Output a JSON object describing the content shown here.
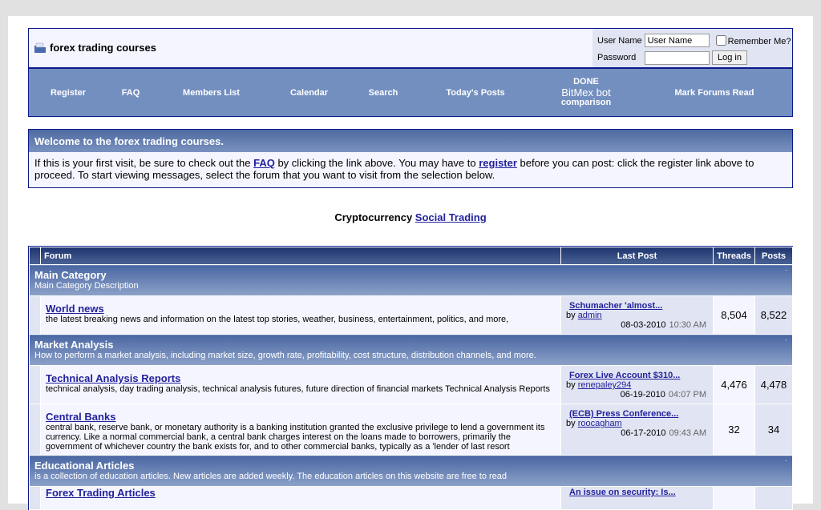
{
  "header": {
    "title": "forex trading courses",
    "login": {
      "username_label": "User Name",
      "username_value": "User Name",
      "remember_label": "Remember Me?",
      "password_label": "Password",
      "login_button": "Log in"
    }
  },
  "nav": {
    "items": [
      "Register",
      "FAQ",
      "Members List",
      "Calendar",
      "Search",
      "Today's Posts"
    ],
    "special": {
      "line1": "DONE",
      "line2": "BitMex bot",
      "line3": "comparison"
    },
    "mark_read": "Mark Forums Read"
  },
  "welcome": {
    "title": "Welcome to the forex trading courses.",
    "p1": "If this is your first visit, be sure to check out the ",
    "faq": "FAQ",
    "p2": " by clicking the link above. You may have to ",
    "register": "register",
    "p3": " before you can post: click the register link above to proceed. To start viewing messages, select the forum that you want to visit from the selection below."
  },
  "crypto": {
    "text": "Cryptocurrency ",
    "link": "Social Trading"
  },
  "table": {
    "headers": {
      "forum": "Forum",
      "last_post": "Last Post",
      "threads": "Threads",
      "posts": "Posts"
    },
    "categories": [
      {
        "name": "Main Category",
        "desc": "Main Category Description",
        "forums": [
          {
            "name": "World news",
            "desc": "the latest breaking news and information on the latest top stories, weather, business, entertainment, politics, and more,",
            "last_title": "Schumacher 'almost...",
            "by": "by ",
            "user": "admin",
            "date": "08-03-2010",
            "time": "10:30 AM",
            "threads": "8,504",
            "posts": "8,522"
          }
        ]
      },
      {
        "name": "Market Analysis",
        "desc": "How to perform a market analysis, including market size, growth rate, profitability, cost structure, distribution channels, and more.",
        "forums": [
          {
            "name": "Technical Analysis Reports",
            "desc": "technical analysis, day trading analysis, technical analysis futures, future direction of financial markets Technical Analysis Reports",
            "last_title": "Forex Live Account $310...",
            "by": "by ",
            "user": "renepaley294",
            "date": "06-19-2010",
            "time": "04:07 PM",
            "threads": "4,476",
            "posts": "4,478"
          },
          {
            "name": "Central Banks",
            "desc": "central bank, reserve bank, or monetary authority is a banking institution granted the exclusive privilege to lend a government its currency. Like a normal commercial bank, a central bank charges interest on the loans made to borrowers, primarily the government of whichever country the bank exists for, and to other commercial banks, typically as a 'lender of last resort",
            "last_title": "(ECB) Press Conference...",
            "by": "by ",
            "user": "roocagham",
            "date": "06-17-2010",
            "time": "09:43 AM",
            "threads": "32",
            "posts": "34"
          }
        ]
      },
      {
        "name": "Educational Articles",
        "desc": "is a collection of education articles. New articles are added weekly. The education articles on this website are free to read",
        "forums": [
          {
            "name": "Forex Trading Articles",
            "desc": "",
            "last_title": "An issue on security: Is...",
            "by": "",
            "user": "",
            "date": "",
            "time": "",
            "threads": "",
            "posts": ""
          }
        ]
      }
    ]
  }
}
